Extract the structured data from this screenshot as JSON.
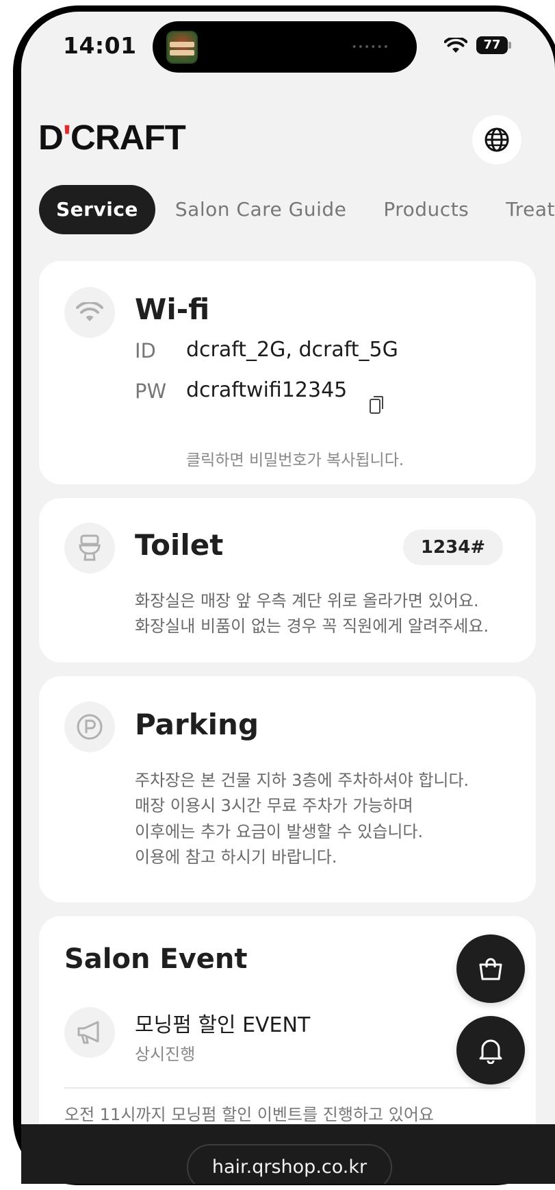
{
  "status_bar": {
    "time": "14:01",
    "battery": "77"
  },
  "header": {
    "logo_mark": "D",
    "logo_tick": "'",
    "logo_text": "CRAFT",
    "language_icon": "globe-icon"
  },
  "tabs": [
    {
      "label": "Service",
      "active": true
    },
    {
      "label": "Salon Care Guide",
      "active": false
    },
    {
      "label": "Products",
      "active": false
    },
    {
      "label": "Treatment",
      "active": false
    }
  ],
  "wifi": {
    "title": "Wi-fi",
    "id_label": "ID",
    "id_value": "dcraft_2G, dcraft_5G",
    "pw_label": "PW",
    "pw_value": "dcraftwifi12345",
    "hint": "클릭하면 비밀번호가 복사됩니다."
  },
  "toilet": {
    "title": "Toilet",
    "code": "1234#",
    "lines": [
      "화장실은 매장 앞 우측 계단 위로 올라가면 있어요.",
      "화장실내 비품이 없는 경우 꼭 직원에게 알려주세요."
    ]
  },
  "parking": {
    "title": "Parking",
    "lines": [
      "주차장은 본 건물 지하 3층에 주차하셔야 합니다.",
      "매장 이용시 3시간 무료 주차가 가능하며",
      "이후에는 추가 요금이 발생할 수 있습니다.",
      "이용에 참고 하시기 바랍니다."
    ]
  },
  "salon_event": {
    "title": "Salon Event",
    "event_name": "모닝펌 할인 EVENT",
    "event_status": "상시진행",
    "body_partial": "오전 11시까지 모닝펌 할인 이벤트를 진행하고 있어요"
  },
  "browser": {
    "url": "hair.qrshop.co.kr"
  },
  "colors": {
    "accent": "#1e1e1e",
    "logo_tick": "#e4292b",
    "background": "#f2f2f2"
  }
}
